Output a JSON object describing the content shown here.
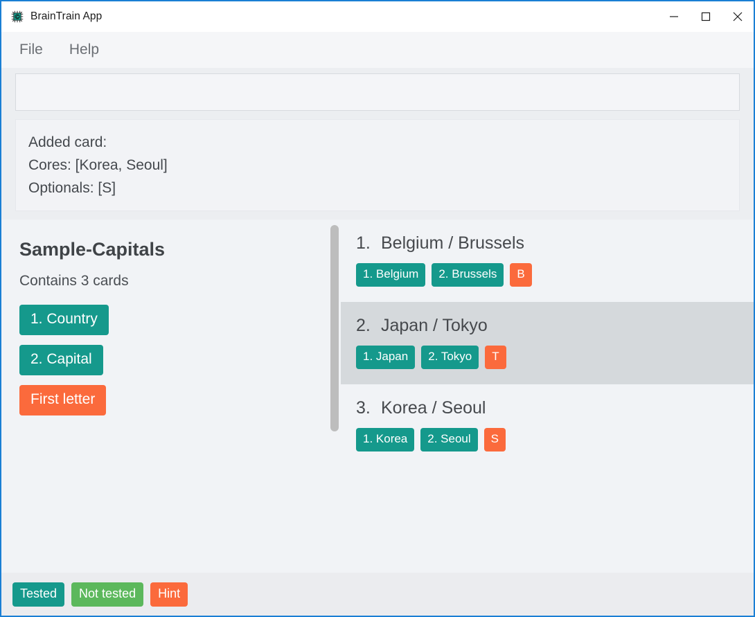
{
  "window": {
    "title": "BrainTrain App",
    "icon": "chip-icon",
    "border_color": "#1a7fd4",
    "controls": [
      {
        "name": "minimize",
        "glyph": "minimize-icon"
      },
      {
        "name": "maximize",
        "glyph": "maximize-icon"
      },
      {
        "name": "close",
        "glyph": "close-icon"
      }
    ]
  },
  "menubar": {
    "items": [
      {
        "label": "File"
      },
      {
        "label": "Help"
      }
    ]
  },
  "input": {
    "value": "",
    "placeholder": ""
  },
  "message": {
    "lines": [
      "Added card:",
      "Cores: [Korea, Seoul]",
      "Optionals: [S]"
    ]
  },
  "deck": {
    "title": "Sample-Capitals",
    "subtitle": "Contains 3 cards",
    "fields": [
      {
        "label": "1. Country",
        "color": "#15998c"
      },
      {
        "label": "2. Capital",
        "color": "#15998c"
      },
      {
        "label": "First letter",
        "color": "#fb6a3c"
      }
    ]
  },
  "cards": [
    {
      "index": "1.",
      "text": "Belgium / Brussels",
      "selected": false,
      "chips": [
        {
          "label": "1. Belgium",
          "color": "#15998c"
        },
        {
          "label": "2. Brussels",
          "color": "#15998c"
        },
        {
          "label": "B",
          "color": "#fb6a3c"
        }
      ]
    },
    {
      "index": "2.",
      "text": "Japan / Tokyo",
      "selected": true,
      "chips": [
        {
          "label": "1. Japan",
          "color": "#15998c"
        },
        {
          "label": "2. Tokyo",
          "color": "#15998c"
        },
        {
          "label": "T",
          "color": "#fb6a3c"
        }
      ]
    },
    {
      "index": "3.",
      "text": "Korea / Seoul",
      "selected": false,
      "chips": [
        {
          "label": "1. Korea",
          "color": "#15998c"
        },
        {
          "label": "2. Seoul",
          "color": "#15998c"
        },
        {
          "label": "S",
          "color": "#fb6a3c"
        }
      ]
    }
  ],
  "legend": [
    {
      "label": "Tested",
      "color": "#15998c"
    },
    {
      "label": "Not tested",
      "color": "#5cb85c"
    },
    {
      "label": "Hint",
      "color": "#fb6a3c"
    }
  ],
  "scrollbar": {
    "thumb_color": "#bdbdbd"
  }
}
